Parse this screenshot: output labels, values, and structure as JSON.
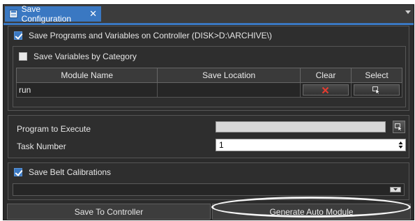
{
  "tab": {
    "title": "Save Configuration",
    "close_glyph": "✕"
  },
  "save_programs": {
    "label": "Save Programs and Variables on Controller (DISK>D:\\ARCHIVE\\)",
    "checked": true
  },
  "save_by_category": {
    "label": "Save Variables by Category",
    "checked": false
  },
  "module_table": {
    "headers": {
      "module_name": "Module Name",
      "save_location": "Save Location",
      "clear": "Clear",
      "select": "Select"
    },
    "rows": [
      {
        "module_name": "run",
        "save_location": ""
      }
    ]
  },
  "program_to_execute": {
    "label": "Program to Execute",
    "value": ""
  },
  "task_number": {
    "label": "Task Number",
    "value": "1"
  },
  "save_belt_calibrations": {
    "label": "Save Belt Calibrations",
    "checked": true
  },
  "buttons": {
    "save_to_controller": "Save To Controller",
    "generate_auto_module": "Generate Auto Module"
  },
  "colors": {
    "accent": "#3a78c2",
    "background": "#2b2b2b",
    "clear_icon": "#e03c31"
  },
  "icons": {
    "tab": "save-config-icon",
    "clear": "red-x-icon",
    "select": "select-cursor-icon",
    "browse": "select-cursor-icon",
    "spinner": "up-down-spinner-icon",
    "belt_dropdown": "dropdown-arrow-icon"
  }
}
